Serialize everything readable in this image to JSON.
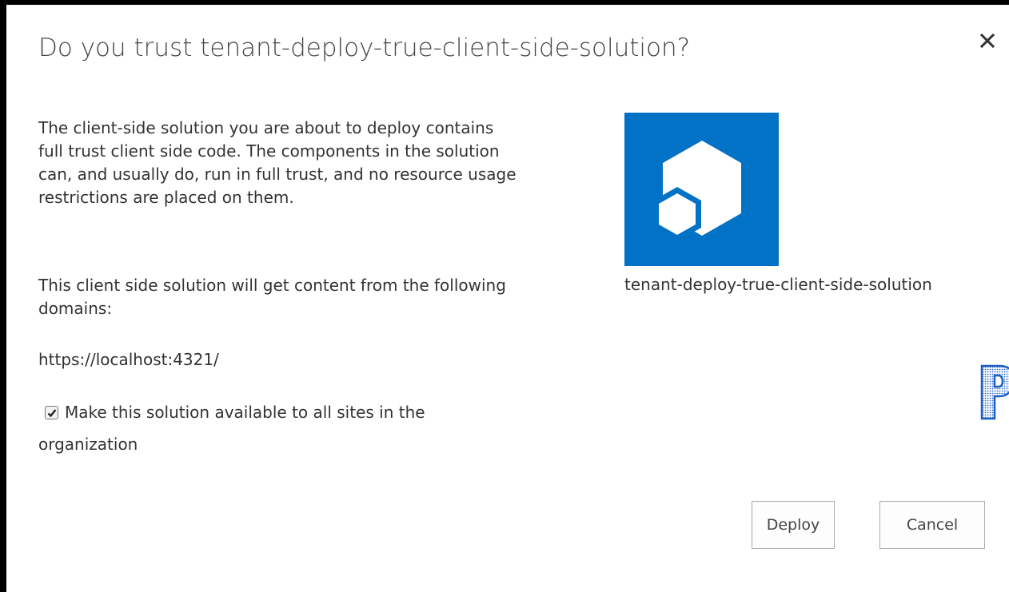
{
  "dialog": {
    "title": "Do you trust tenant-deploy-true-client-side-solution?",
    "close_icon": "close-icon",
    "paragraphs": [
      "The client-side solution you are about to deploy contains full trust client side code. The components in the solution can, and usually do, run in full trust, and no resource usage restrictions are placed on them.",
      "This client side solution will get content from the following domains:",
      "https://localhost:4321/"
    ],
    "checkbox": {
      "checked": true,
      "label": "Make this solution available to all sites in the organization"
    },
    "solution": {
      "name": "tenant-deploy-true-client-side-solution",
      "icon": "package-cubes-icon",
      "tile_color": "#0272c6"
    },
    "buttons": {
      "deploy_label": "Deploy",
      "cancel_label": "Cancel"
    },
    "watermark_text": "p"
  }
}
